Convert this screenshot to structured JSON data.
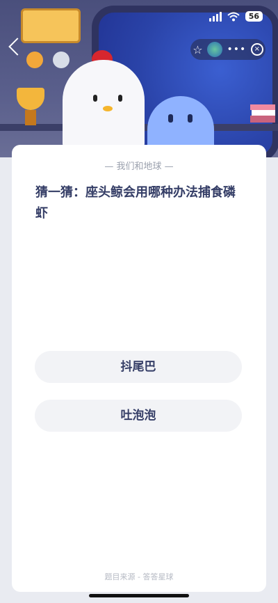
{
  "status_bar": {
    "battery": "56"
  },
  "quiz": {
    "tag": "— 我们和地球 —",
    "question": "猜一猜：座头鲸会用哪种办法捕食磷虾",
    "options": [
      "抖尾巴",
      "吐泡泡"
    ],
    "source": "题目来源 - 答答星球"
  }
}
